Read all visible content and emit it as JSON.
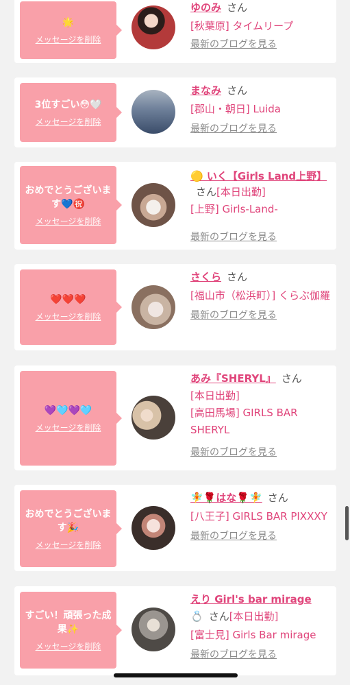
{
  "entries": [
    {
      "message": "🌟",
      "delete_label": "メッセージを削除",
      "name": "ゆのみ",
      "san": "さん",
      "status": "",
      "shop": "[秋葉原] タイムリープ",
      "blog_label": "最新のブログを見る",
      "avatar_color": "#b33a3a"
    },
    {
      "message": "3位すごい😳🤍",
      "delete_label": "メッセージを削除",
      "name": "まなみ",
      "san": "さん",
      "status": "",
      "shop": "[郡山・朝日] Luida",
      "blog_label": "最新のブログを見る",
      "avatar_color": "#6d7f99"
    },
    {
      "message": "おめでとうございます💙㊗️",
      "delete_label": "メッセージを削除",
      "name": "🟡 いく【Girls Land上野】",
      "san": "さん",
      "status": "[本日出勤]",
      "shop": "[上野] Girls-Land-",
      "blog_label": "最新のブログを見る",
      "avatar_color": "#a88f80"
    },
    {
      "message": "❤️❤️❤️",
      "delete_label": "メッセージを削除",
      "name": "さくら",
      "san": "さん",
      "status": "",
      "shop": "[福山市（松浜町）] くらぶ伽羅",
      "blog_label": "最新のブログを見る",
      "avatar_color": "#c9b4a3"
    },
    {
      "message": "💜🩵💜🩵",
      "delete_label": "メッセージを削除",
      "name": "あみ『SHERYL』",
      "san": "さん",
      "status": "[本日出勤]",
      "shop": "[高田馬場] GIRLS BAR SHERYL",
      "blog_label": "最新のブログを見る",
      "avatar_color": "#8a7b70"
    },
    {
      "message": "おめでとうございます🎉",
      "delete_label": "メッセージを削除",
      "name": "🧚🌹はな🌹🧚",
      "san": "さん",
      "status": "",
      "shop": "[八王子] GIRLS BAR PIXXXY",
      "blog_label": "最新のブログを見る",
      "avatar_color": "#5a4a44"
    },
    {
      "message": "すごい！頑張った成果✨",
      "delete_label": "メッセージを削除",
      "name": "えり Girl's bar mirage",
      "san": "さん",
      "status": "[本日出勤]",
      "name_extra": "💍",
      "shop": "[富士見] Girls Bar mirage",
      "blog_label": "最新のブログを見る",
      "avatar_color": "#9a9590"
    }
  ]
}
